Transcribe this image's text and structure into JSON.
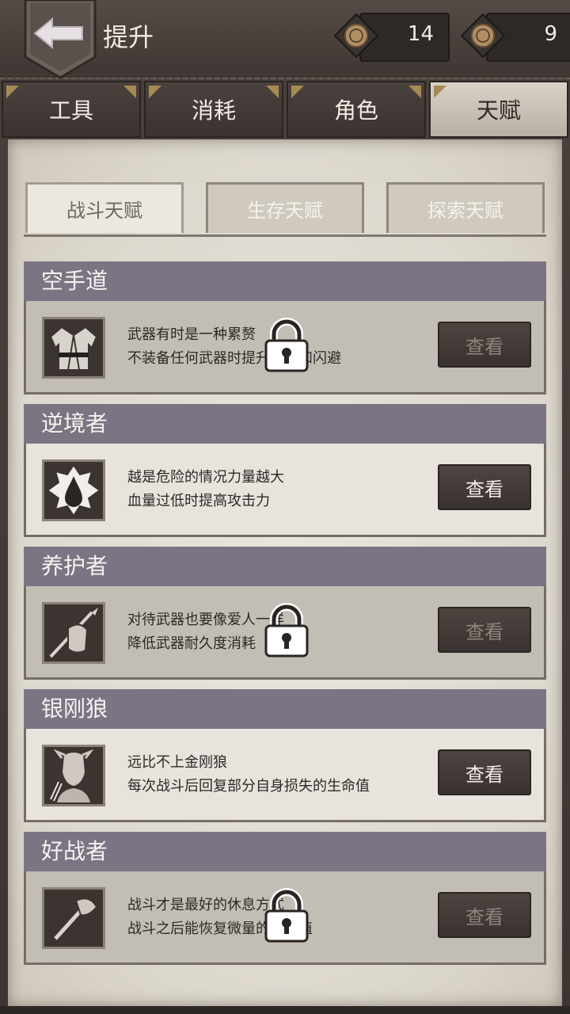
{
  "header": {
    "title": "提升"
  },
  "currencies": [
    {
      "value": "14"
    },
    {
      "value": "9"
    }
  ],
  "tabs": [
    {
      "label": "工具"
    },
    {
      "label": "消耗"
    },
    {
      "label": "角色"
    },
    {
      "label": "天赋"
    }
  ],
  "subtabs": [
    {
      "label": "战斗天赋"
    },
    {
      "label": "生存天赋"
    },
    {
      "label": "探索天赋"
    }
  ],
  "talents": [
    {
      "name": "空手道",
      "line1": "武器有时是一种累赘",
      "line2": "不装备任何武器时提升暴击和闪避",
      "button": "查看",
      "locked": true,
      "icon": "karate-gi-icon"
    },
    {
      "name": "逆境者",
      "line1": "越是危险的情况力量越大",
      "line2": "血量过低时提高攻击力",
      "button": "查看",
      "locked": false,
      "icon": "blood-drop-icon"
    },
    {
      "name": "养护者",
      "line1": "对待武器也要像爱人一样",
      "line2": "降低武器耐久度消耗",
      "button": "查看",
      "locked": true,
      "icon": "spear-glove-icon"
    },
    {
      "name": "银刚狼",
      "line1": "远比不上金刚狼",
      "line2": "每次战斗后回复部分自身损失的生命值",
      "button": "查看",
      "locked": false,
      "icon": "wolverine-icon"
    },
    {
      "name": "好战者",
      "line1": "战斗才是最好的休息方式",
      "line2": "战斗之后能恢复微量的精神值",
      "button": "查看",
      "locked": true,
      "icon": "axe-icon"
    }
  ],
  "colors": {
    "header_bar": "#7c7383",
    "paper": "#e6e2db"
  }
}
